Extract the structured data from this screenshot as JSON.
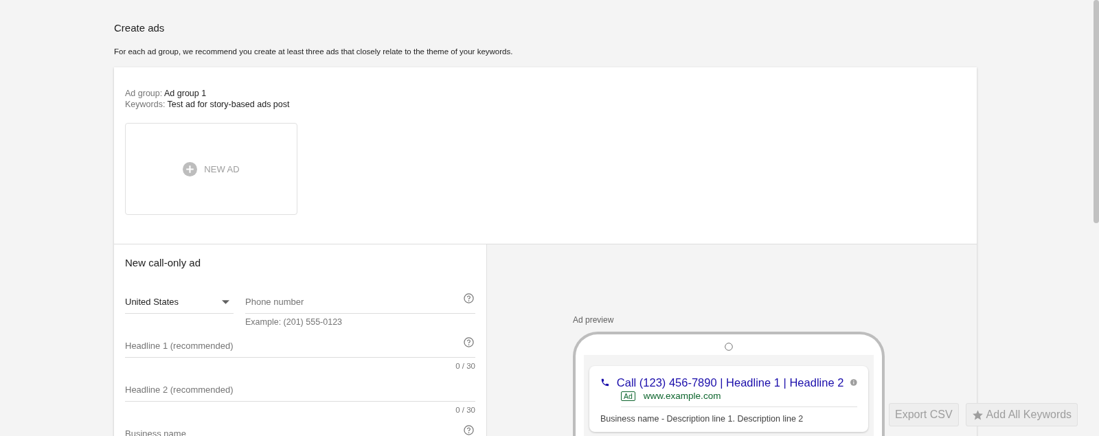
{
  "header": {
    "title": "Create ads",
    "description": "For each ad group, we recommend you create at least three ads that closely relate to the theme of your keywords."
  },
  "ad_group": {
    "label": "Ad group:",
    "value": "Ad group 1"
  },
  "keywords": {
    "label": "Keywords:",
    "value": "Test ad for story-based ads post"
  },
  "new_ad_button": "NEW AD",
  "form": {
    "title": "New call-only ad",
    "country": {
      "value": "United States"
    },
    "phone": {
      "placeholder": "Phone number",
      "hint": "Example: (201) 555-0123",
      "help": true
    },
    "fields": [
      {
        "placeholder": "Headline 1 (recommended)",
        "help": true,
        "counter": "0 / 30"
      },
      {
        "placeholder": "Headline 2 (recommended)",
        "help": false,
        "counter": "0 / 30"
      },
      {
        "placeholder": "Business name",
        "help": true
      }
    ]
  },
  "preview": {
    "label": "Ad preview",
    "headline": "Call (123) 456-7890 | Headline 1 | Headline 2",
    "badge": "Ad",
    "url": "www.example.com",
    "description": "Business name - Description line 1. Description line 2"
  },
  "actions": [
    {
      "label": "Export CSV",
      "kind": "plain"
    },
    {
      "label": "Add All Keywords",
      "kind": "star"
    }
  ]
}
